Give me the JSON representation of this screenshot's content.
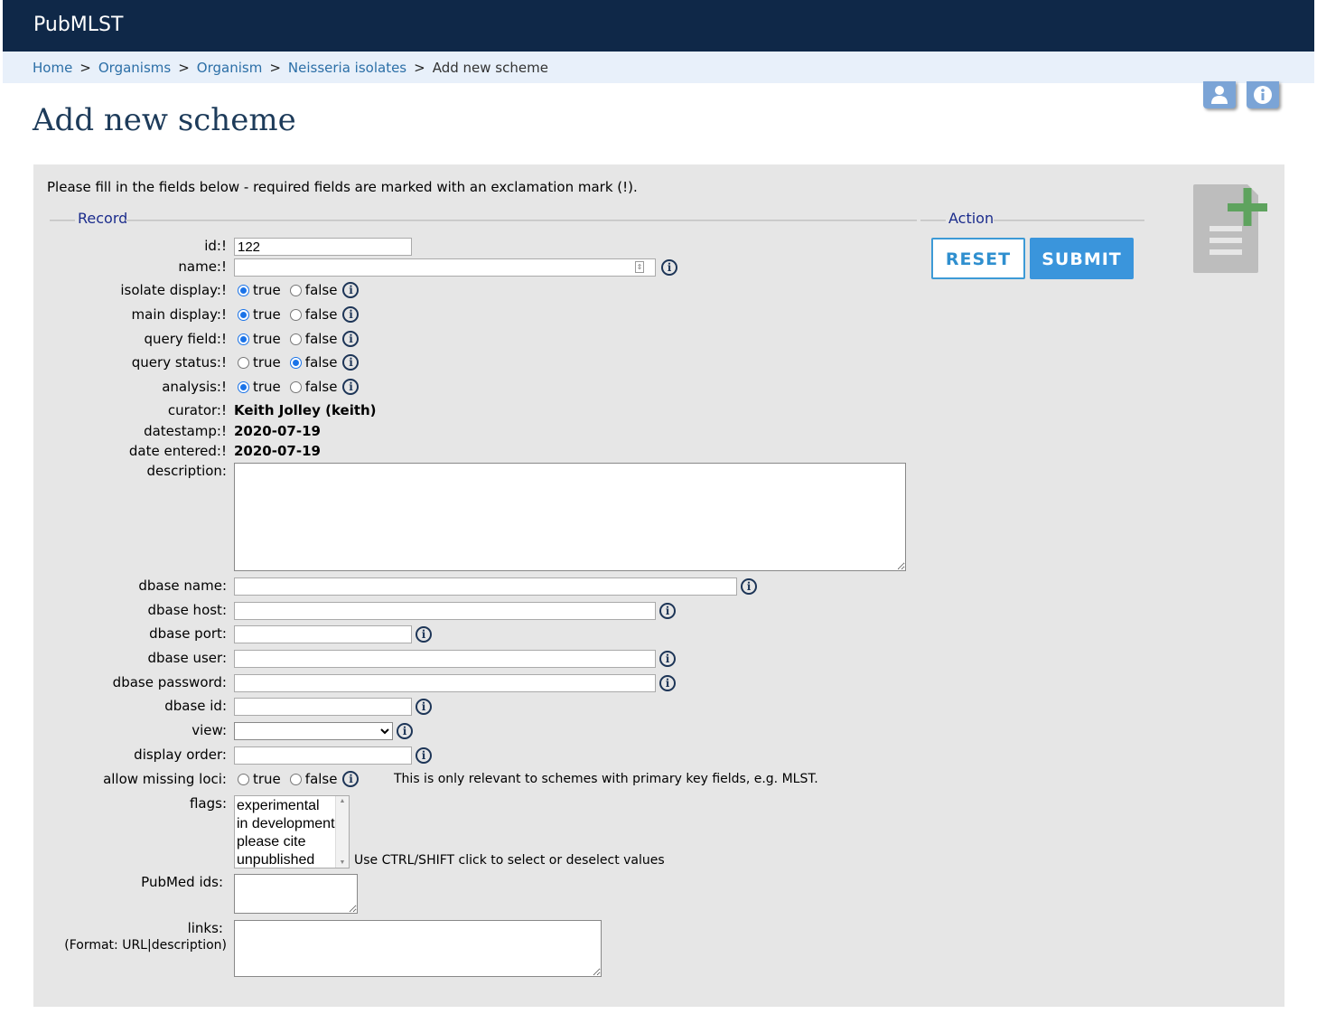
{
  "app": {
    "brand": "PubMLST"
  },
  "breadcrumb": {
    "items": [
      "Home",
      "Organisms",
      "Organism",
      "Neisseria isolates"
    ],
    "current": "Add new scheme",
    "separator": ">"
  },
  "page": {
    "title": "Add new scheme"
  },
  "form": {
    "intro": "Please fill in the fields below - required fields are marked with an exclamation mark (!).",
    "record_legend": "Record",
    "action_legend": "Action",
    "reset_label": "RESET",
    "submit_label": "SUBMIT",
    "radio_true": "true",
    "radio_false": "false",
    "fields": {
      "id": {
        "label": "id:!",
        "value": "122"
      },
      "name": {
        "label": "name:!",
        "value": ""
      },
      "isolate_display": {
        "label": "isolate display:!",
        "selected": "true"
      },
      "main_display": {
        "label": "main display:!",
        "selected": "true"
      },
      "query_field": {
        "label": "query field:!",
        "selected": "true"
      },
      "query_status": {
        "label": "query status:!",
        "selected": "false"
      },
      "analysis": {
        "label": "analysis:!",
        "selected": "true"
      },
      "curator": {
        "label": "curator:!",
        "value": "Keith Jolley (keith)"
      },
      "datestamp": {
        "label": "datestamp:!",
        "value": "2020-07-19"
      },
      "date_entered": {
        "label": "date entered:!",
        "value": "2020-07-19"
      },
      "description": {
        "label": "description:",
        "value": ""
      },
      "dbase_name": {
        "label": "dbase name:",
        "value": ""
      },
      "dbase_host": {
        "label": "dbase host:",
        "value": ""
      },
      "dbase_port": {
        "label": "dbase port:",
        "value": ""
      },
      "dbase_user": {
        "label": "dbase user:",
        "value": ""
      },
      "dbase_password": {
        "label": "dbase password:",
        "value": ""
      },
      "dbase_id": {
        "label": "dbase id:",
        "value": ""
      },
      "view": {
        "label": "view:",
        "value": ""
      },
      "display_order": {
        "label": "display order:",
        "value": ""
      },
      "allow_missing_loci": {
        "label": "allow missing loci:",
        "selected": "",
        "note": "This is only relevant to schemes with primary key fields, e.g. MLST."
      },
      "flags": {
        "label": "flags:",
        "options": [
          "experimental",
          "in development",
          "please cite",
          "unpublished"
        ],
        "note": "Use CTRL/SHIFT click to select or deselect values"
      },
      "pubmed_ids": {
        "label": "PubMed ids:",
        "value": ""
      },
      "links": {
        "label": "links:",
        "sublabel": "(Format: URL|description)",
        "value": ""
      }
    }
  },
  "icons": {
    "info": "info-icon",
    "user": "user-icon",
    "help": "help-icon",
    "add_document": "add-document-icon"
  }
}
